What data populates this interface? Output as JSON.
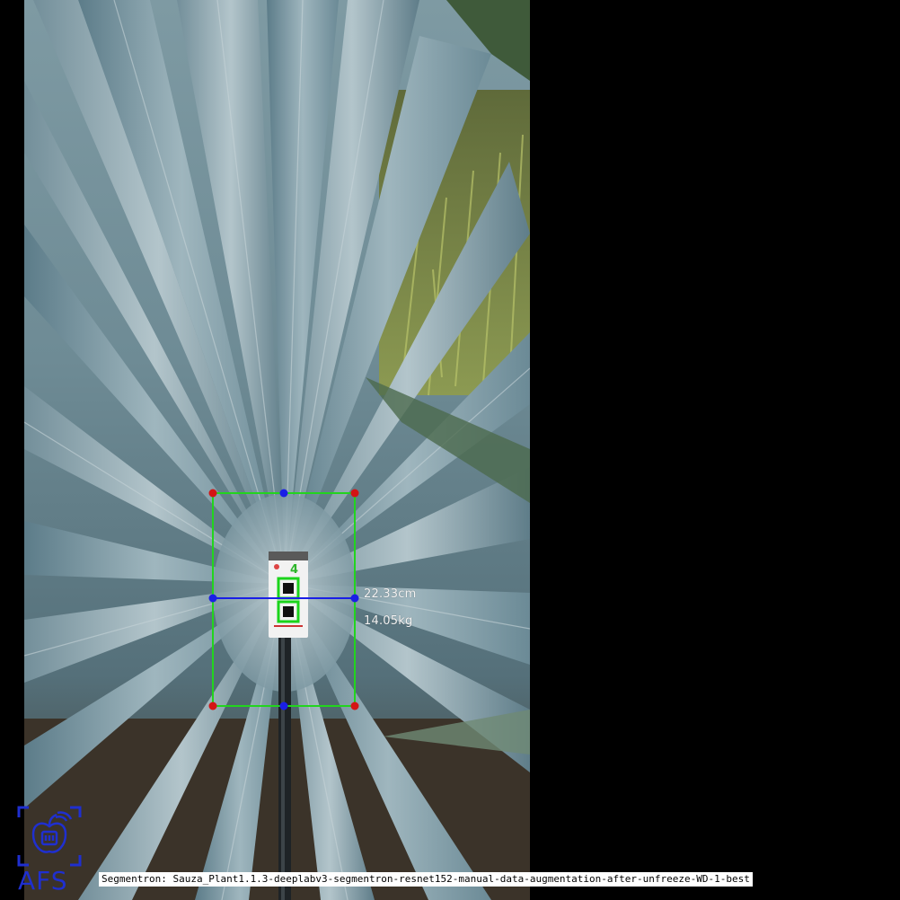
{
  "measurements": {
    "width_text": "22.33cm",
    "weight_text": "14.05kg"
  },
  "caption": {
    "text": "Segmentron: Sauza_Plant1.1.3-deeplabv3-segmentron-resnet152-manual-data-augmentation-after-unfreeze-WD-1-best"
  },
  "logo": {
    "text": "AFS"
  },
  "colors": {
    "bbox_green": "#22d41e",
    "axis_blue": "#1a1fe6",
    "corner_red": "#d41414",
    "logo_blue": "#1f2fd0",
    "agave_leaf": "#6d8f9c"
  },
  "icons": {
    "logo_emblem": "apple-with-chip-in-scan-brackets-icon"
  }
}
